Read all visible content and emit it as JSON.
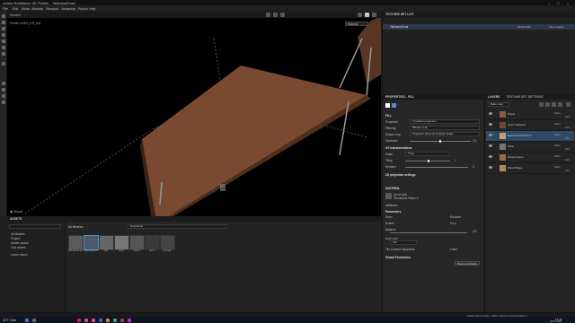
{
  "window": {
    "title": "Adobe Substance 3D Painter - TableandChair"
  },
  "menu": [
    "File",
    "Edit",
    "Mode",
    "Window",
    "Viewport",
    "Javascript",
    "Python",
    "Help"
  ],
  "viewport": {
    "profile_text": "Profile: ACES_ER_Ind",
    "camera_dropdown": "Material",
    "mode_label": "Shaded"
  },
  "texture_set_list": {
    "title": "TEXTURE SET LIST",
    "active_set": "TableandChair",
    "set_resolution": "2048x2048",
    "shader": "Main shader"
  },
  "properties": {
    "title": "PROPERTIES - FILL",
    "fill_section": "FILL",
    "projection_label": "Projection",
    "projection_value": "Tri-planar projection",
    "filtering_label": "Filtering",
    "filtering_value": "Bilinear | HQ",
    "shape_crop_label": "Shape Crop",
    "shape_crop_value": "Projection Extends Outside Shape",
    "hardness_label": "Hardness",
    "hardness_value": "0.5",
    "uv_transform_section": "UV transformations",
    "scale_label": "Scale",
    "scale_value": "Tiling",
    "tiling_label": "Tiling",
    "tiling_value": "1",
    "rotation_label": "Rotation",
    "rotation_value": "0",
    "projection_settings": "3D projection settings",
    "material_section": "MATERIAL",
    "material_name": "wood walk",
    "material_sub": "Directional Fabric 1",
    "attributes_label": "Attributes",
    "parameters_section": "Parameters",
    "param_rows": [
      {
        "label": "Seed",
        "value": "Random"
      },
      {
        "label": "Scales",
        "value": "Prox"
      },
      {
        "label": "Balance",
        "value": "0.5"
      },
      {
        "label": "Use Load",
        "value": "Yes"
      },
      {
        "label": "Tile Ceased Separation",
        "value": "False"
      }
    ],
    "global_params_section": "Global Parameters",
    "restore_button": "Restore defaults",
    "uniform_label": "Uniform"
  },
  "layers": {
    "tab_layers": "LAYERS",
    "tab_texture_settings": "TEXTURE SET SETTINGS",
    "base_color_dropdown": "Base color",
    "items": [
      {
        "name": "Wood",
        "mode": "Norm",
        "opacity": "100",
        "color": "#8a5a3c"
      },
      {
        "name": "Color Variation",
        "mode": "Norm",
        "opacity": "100",
        "color": "#6a4a35"
      },
      {
        "name": "Directional Fabric 1",
        "mode": "Norm",
        "opacity": "100",
        "color": "#c2a07a"
      },
      {
        "name": "Steel",
        "mode": "Norm",
        "opacity": "100",
        "color": "#777777"
      },
      {
        "name": "Wood Colour",
        "mode": "Norm",
        "opacity": "100",
        "color": "#a06a40"
      },
      {
        "name": "Wood Base",
        "mode": "Norm",
        "opacity": "100",
        "color": "#b08860"
      }
    ]
  },
  "assets": {
    "title": "ASSETS",
    "search_placeholder": "Directional",
    "breadcrumb": "All libraries",
    "tree": [
      "All libraries",
      "Project",
      "Starter assets",
      "Your assets"
    ],
    "tree_extra": "Lorem Ipsum",
    "thumbs": [
      "Directional Fabric",
      "Directional 2",
      "Dirt",
      "Dust",
      "Fabric",
      "Dirt 2",
      "Grunge"
    ]
  },
  "status": {
    "text": "Cache Disk Usage : 95% | Version 9.0.0 (Custom)"
  },
  "taskbar": {
    "time": "12:35",
    "date": "24-01-2024",
    "weather": "42°F Clear"
  }
}
